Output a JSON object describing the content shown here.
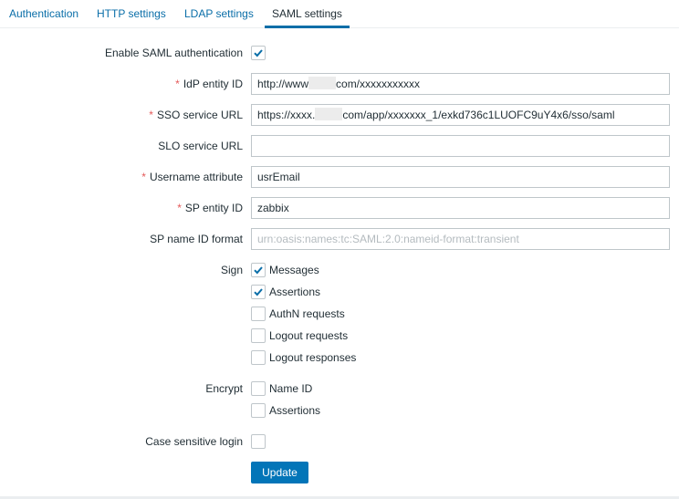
{
  "tabs": [
    {
      "label": "Authentication",
      "active": false
    },
    {
      "label": "HTTP settings",
      "active": false
    },
    {
      "label": "LDAP settings",
      "active": false
    },
    {
      "label": "SAML settings",
      "active": true
    }
  ],
  "form": {
    "enable_saml": {
      "label": "Enable SAML authentication",
      "checked": true
    },
    "idp_entity_id": {
      "label": "IdP entity ID",
      "required": true,
      "value_prefix": "http://www",
      "value_suffix": "com/xxxxxxxxxxx"
    },
    "sso_service_url": {
      "label": "SSO service URL",
      "required": true,
      "value_prefix": "https://xxxx.",
      "value_suffix": "com/app/xxxxxxx_1/exkd736c1LUOFC9uY4x6/sso/saml"
    },
    "slo_service_url": {
      "label": "SLO service URL",
      "required": false,
      "value": ""
    },
    "username_attribute": {
      "label": "Username attribute",
      "required": true,
      "value": "usrEmail"
    },
    "sp_entity_id": {
      "label": "SP entity ID",
      "required": true,
      "value": "zabbix"
    },
    "sp_name_id_format": {
      "label": "SP name ID format",
      "required": false,
      "value": "",
      "placeholder": "urn:oasis:names:tc:SAML:2.0:nameid-format:transient"
    },
    "sign": {
      "label": "Sign",
      "options": [
        {
          "label": "Messages",
          "checked": true
        },
        {
          "label": "Assertions",
          "checked": true
        },
        {
          "label": "AuthN requests",
          "checked": false
        },
        {
          "label": "Logout requests",
          "checked": false
        },
        {
          "label": "Logout responses",
          "checked": false
        }
      ]
    },
    "encrypt": {
      "label": "Encrypt",
      "options": [
        {
          "label": "Name ID",
          "checked": false
        },
        {
          "label": "Assertions",
          "checked": false
        }
      ]
    },
    "case_sensitive_login": {
      "label": "Case sensitive login",
      "checked": false
    },
    "required_marker": "*"
  },
  "buttons": {
    "update": "Update"
  },
  "colors": {
    "accent": "#0275b8",
    "link": "#0a6ea8",
    "required": "#e45959",
    "check": "#0a6ea8"
  }
}
